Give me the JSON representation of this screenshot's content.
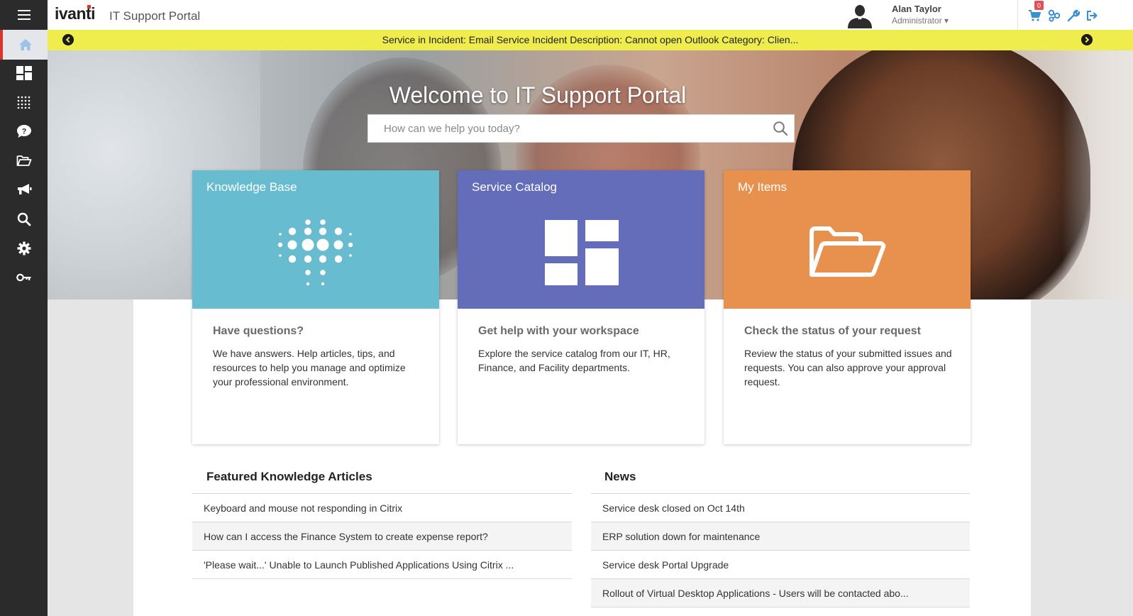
{
  "app": {
    "logo_text": "ivanti",
    "portal_title": "IT Support Portal"
  },
  "user": {
    "name": "Alan Taylor",
    "role": "Administrator ▾"
  },
  "toolbar": {
    "cart_count": "0",
    "icons": [
      "cart-icon",
      "network-icon",
      "wrench-icon",
      "logout-icon"
    ]
  },
  "sidebar": {
    "items": [
      {
        "name": "home-icon",
        "active": true
      },
      {
        "name": "dashboard-icon"
      },
      {
        "name": "grid-icon"
      },
      {
        "name": "help-icon"
      },
      {
        "name": "folder-icon"
      },
      {
        "name": "announcement-icon"
      },
      {
        "name": "search-icon"
      },
      {
        "name": "settings-icon"
      },
      {
        "name": "key-icon"
      }
    ]
  },
  "ticker": {
    "text": "Service in Incident: Email Service Incident Description: Cannot open Outlook Category: Clien..."
  },
  "hero": {
    "title": "Welcome to IT Support Portal",
    "search_placeholder": "How can we help you today?"
  },
  "tiles": [
    {
      "label": "Knowledge Base",
      "color": "#67bccf",
      "subtitle": "Have questions?",
      "description": "We have answers. Help articles, tips, and resources to help you manage and optimize your professional environment."
    },
    {
      "label": "Service Catalog",
      "color": "#646dba",
      "subtitle": "Get help with your workspace",
      "description": "Explore the service catalog from our IT, HR, Finance, and Facility departments."
    },
    {
      "label": "My Items",
      "color": "#e8914f",
      "subtitle": "Check the status of your request",
      "description": "Review the status of your submitted issues and requests. You can also approve your approval request."
    }
  ],
  "featured": {
    "title": "Featured Knowledge Articles",
    "items": [
      "Keyboard and mouse not responding in Citrix",
      "How can I access the Finance System to create expense report?",
      "'Please wait...' Unable to Launch Published Applications Using Citrix ..."
    ]
  },
  "news": {
    "title": "News",
    "items": [
      "Service desk closed on Oct 14th",
      "ERP solution down for maintenance",
      "Service desk Portal Upgrade",
      "Rollout of Virtual Desktop Applications - Users will be contacted abo..."
    ]
  },
  "colors": {
    "sidebar_bg": "#2b2b2b",
    "ticker_bg": "#efec4d",
    "accent_red": "#d9342b",
    "icon_blue": "#3a8fd0"
  }
}
